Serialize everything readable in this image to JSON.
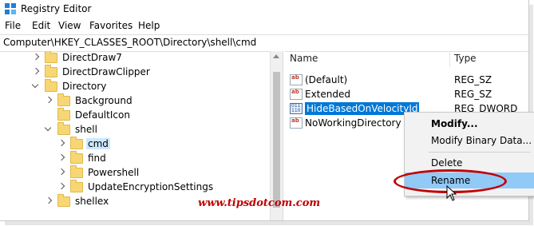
{
  "window": {
    "title": "Registry Editor"
  },
  "menu": [
    "File",
    "Edit",
    "View",
    "Favorites",
    "Help"
  ],
  "address": "Computer\\HKEY_CLASSES_ROOT\\Directory\\shell\\cmd",
  "tree": [
    {
      "label": "DirectDraw7",
      "chev": "right",
      "level": 0,
      "selected": false
    },
    {
      "label": "DirectDrawClipper",
      "chev": "right",
      "level": 0,
      "selected": false
    },
    {
      "label": "Directory",
      "chev": "down",
      "level": 0,
      "selected": false
    },
    {
      "label": "Background",
      "chev": "right",
      "level": 1,
      "selected": false
    },
    {
      "label": "DefaultIcon",
      "chev": "",
      "level": 1,
      "selected": false
    },
    {
      "label": "shell",
      "chev": "down",
      "level": 1,
      "selected": false
    },
    {
      "label": "cmd",
      "chev": "right",
      "level": 2,
      "selected": true
    },
    {
      "label": "find",
      "chev": "right",
      "level": 2,
      "selected": false
    },
    {
      "label": "Powershell",
      "chev": "right",
      "level": 2,
      "selected": false
    },
    {
      "label": "UpdateEncryptionSettings",
      "chev": "right",
      "level": 2,
      "selected": false
    },
    {
      "label": "shellex",
      "chev": "right",
      "level": 1,
      "selected": false
    }
  ],
  "list": {
    "headers": {
      "name": "Name",
      "type": "Type"
    },
    "rows": [
      {
        "name": "(Default)",
        "type": "REG_SZ",
        "icon": "string-value-icon",
        "selected": false
      },
      {
        "name": "Extended",
        "type": "REG_SZ",
        "icon": "string-value-icon",
        "selected": false
      },
      {
        "name": "HideBasedOnVelocityId",
        "type": "REG_DWORD",
        "icon": "binary-value-icon",
        "selected": true
      },
      {
        "name": "NoWorkingDirectory",
        "type": "",
        "icon": "string-value-icon",
        "selected": false
      }
    ]
  },
  "context_menu": {
    "modify": "Modify...",
    "modify_binary": "Modify Binary Data...",
    "delete": "Delete",
    "rename": "Rename"
  },
  "watermark": "www.tipsdotcom.com",
  "colors": {
    "selection": "#0078d7",
    "highlight_ring": "#c00000",
    "folder": "#f7d774"
  }
}
